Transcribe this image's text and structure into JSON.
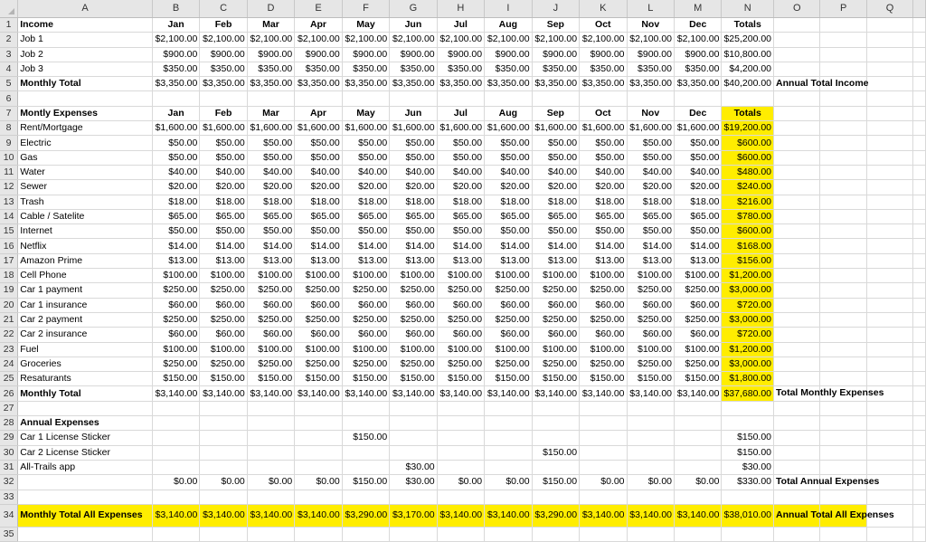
{
  "columns": [
    "A",
    "B",
    "C",
    "D",
    "E",
    "F",
    "G",
    "H",
    "I",
    "J",
    "K",
    "L",
    "M",
    "N",
    "O",
    "P",
    "Q"
  ],
  "highlight_color": "#ffed00",
  "rows": [
    {
      "n": "1",
      "a": "Income",
      "bold": true,
      "hdr": true,
      "vals": [
        "Jan",
        "Feb",
        "Mar",
        "Apr",
        "May",
        "Jun",
        "Jul",
        "Aug",
        "Sep",
        "Oct",
        "Nov",
        "Dec"
      ],
      "total": "Totals",
      "note": ""
    },
    {
      "n": "2",
      "a": "Job 1",
      "vals": [
        "$2,100.00",
        "$2,100.00",
        "$2,100.00",
        "$2,100.00",
        "$2,100.00",
        "$2,100.00",
        "$2,100.00",
        "$2,100.00",
        "$2,100.00",
        "$2,100.00",
        "$2,100.00",
        "$2,100.00"
      ],
      "total": "$25,200.00",
      "note": ""
    },
    {
      "n": "3",
      "a": "Job 2",
      "vals": [
        "$900.00",
        "$900.00",
        "$900.00",
        "$900.00",
        "$900.00",
        "$900.00",
        "$900.00",
        "$900.00",
        "$900.00",
        "$900.00",
        "$900.00",
        "$900.00"
      ],
      "total": "$10,800.00",
      "note": ""
    },
    {
      "n": "4",
      "a": "Job 3",
      "vals": [
        "$350.00",
        "$350.00",
        "$350.00",
        "$350.00",
        "$350.00",
        "$350.00",
        "$350.00",
        "$350.00",
        "$350.00",
        "$350.00",
        "$350.00",
        "$350.00"
      ],
      "total": "$4,200.00",
      "note": ""
    },
    {
      "n": "5",
      "a": "Monthly Total",
      "bold": true,
      "vals": [
        "$3,350.00",
        "$3,350.00",
        "$3,350.00",
        "$3,350.00",
        "$3,350.00",
        "$3,350.00",
        "$3,350.00",
        "$3,350.00",
        "$3,350.00",
        "$3,350.00",
        "$3,350.00",
        "$3,350.00"
      ],
      "total": "$40,200.00",
      "note": "Annual Total Income"
    },
    {
      "n": "6",
      "a": "",
      "vals": [
        "",
        "",
        "",
        "",
        "",
        "",
        "",
        "",
        "",
        "",
        "",
        ""
      ],
      "total": "",
      "note": ""
    },
    {
      "n": "7",
      "a": "Montly Expenses",
      "bold": true,
      "hdr": true,
      "vals": [
        "Jan",
        "Feb",
        "Mar",
        "Apr",
        "May",
        "Jun",
        "Jul",
        "Aug",
        "Sep",
        "Oct",
        "Nov",
        "Dec"
      ],
      "total": "Totals",
      "hlTotal": true,
      "note": ""
    },
    {
      "n": "8",
      "a": "Rent/Mortgage",
      "vals": [
        "$1,600.00",
        "$1,600.00",
        "$1,600.00",
        "$1,600.00",
        "$1,600.00",
        "$1,600.00",
        "$1,600.00",
        "$1,600.00",
        "$1,600.00",
        "$1,600.00",
        "$1,600.00",
        "$1,600.00"
      ],
      "total": "$19,200.00",
      "hlTotal": true,
      "note": ""
    },
    {
      "n": "9",
      "a": "Electric",
      "vals": [
        "$50.00",
        "$50.00",
        "$50.00",
        "$50.00",
        "$50.00",
        "$50.00",
        "$50.00",
        "$50.00",
        "$50.00",
        "$50.00",
        "$50.00",
        "$50.00"
      ],
      "total": "$600.00",
      "hlTotal": true,
      "note": ""
    },
    {
      "n": "10",
      "a": "Gas",
      "vals": [
        "$50.00",
        "$50.00",
        "$50.00",
        "$50.00",
        "$50.00",
        "$50.00",
        "$50.00",
        "$50.00",
        "$50.00",
        "$50.00",
        "$50.00",
        "$50.00"
      ],
      "total": "$600.00",
      "hlTotal": true,
      "note": ""
    },
    {
      "n": "11",
      "a": "Water",
      "vals": [
        "$40.00",
        "$40.00",
        "$40.00",
        "$40.00",
        "$40.00",
        "$40.00",
        "$40.00",
        "$40.00",
        "$40.00",
        "$40.00",
        "$40.00",
        "$40.00"
      ],
      "total": "$480.00",
      "hlTotal": true,
      "note": ""
    },
    {
      "n": "12",
      "a": "Sewer",
      "vals": [
        "$20.00",
        "$20.00",
        "$20.00",
        "$20.00",
        "$20.00",
        "$20.00",
        "$20.00",
        "$20.00",
        "$20.00",
        "$20.00",
        "$20.00",
        "$20.00"
      ],
      "total": "$240.00",
      "hlTotal": true,
      "note": ""
    },
    {
      "n": "13",
      "a": "Trash",
      "vals": [
        "$18.00",
        "$18.00",
        "$18.00",
        "$18.00",
        "$18.00",
        "$18.00",
        "$18.00",
        "$18.00",
        "$18.00",
        "$18.00",
        "$18.00",
        "$18.00"
      ],
      "total": "$216.00",
      "hlTotal": true,
      "note": ""
    },
    {
      "n": "14",
      "a": "Cable / Satelite",
      "vals": [
        "$65.00",
        "$65.00",
        "$65.00",
        "$65.00",
        "$65.00",
        "$65.00",
        "$65.00",
        "$65.00",
        "$65.00",
        "$65.00",
        "$65.00",
        "$65.00"
      ],
      "total": "$780.00",
      "hlTotal": true,
      "note": ""
    },
    {
      "n": "15",
      "a": "Internet",
      "vals": [
        "$50.00",
        "$50.00",
        "$50.00",
        "$50.00",
        "$50.00",
        "$50.00",
        "$50.00",
        "$50.00",
        "$50.00",
        "$50.00",
        "$50.00",
        "$50.00"
      ],
      "total": "$600.00",
      "hlTotal": true,
      "note": ""
    },
    {
      "n": "16",
      "a": "Netflix",
      "vals": [
        "$14.00",
        "$14.00",
        "$14.00",
        "$14.00",
        "$14.00",
        "$14.00",
        "$14.00",
        "$14.00",
        "$14.00",
        "$14.00",
        "$14.00",
        "$14.00"
      ],
      "total": "$168.00",
      "hlTotal": true,
      "note": ""
    },
    {
      "n": "17",
      "a": "Amazon Prime",
      "vals": [
        "$13.00",
        "$13.00",
        "$13.00",
        "$13.00",
        "$13.00",
        "$13.00",
        "$13.00",
        "$13.00",
        "$13.00",
        "$13.00",
        "$13.00",
        "$13.00"
      ],
      "total": "$156.00",
      "hlTotal": true,
      "note": ""
    },
    {
      "n": "18",
      "a": "Cell Phone",
      "vals": [
        "$100.00",
        "$100.00",
        "$100.00",
        "$100.00",
        "$100.00",
        "$100.00",
        "$100.00",
        "$100.00",
        "$100.00",
        "$100.00",
        "$100.00",
        "$100.00"
      ],
      "total": "$1,200.00",
      "hlTotal": true,
      "note": ""
    },
    {
      "n": "19",
      "a": "Car 1 payment",
      "vals": [
        "$250.00",
        "$250.00",
        "$250.00",
        "$250.00",
        "$250.00",
        "$250.00",
        "$250.00",
        "$250.00",
        "$250.00",
        "$250.00",
        "$250.00",
        "$250.00"
      ],
      "total": "$3,000.00",
      "hlTotal": true,
      "note": ""
    },
    {
      "n": "20",
      "a": "Car 1 insurance",
      "vals": [
        "$60.00",
        "$60.00",
        "$60.00",
        "$60.00",
        "$60.00",
        "$60.00",
        "$60.00",
        "$60.00",
        "$60.00",
        "$60.00",
        "$60.00",
        "$60.00"
      ],
      "total": "$720.00",
      "hlTotal": true,
      "note": ""
    },
    {
      "n": "21",
      "a": "Car 2 payment",
      "vals": [
        "$250.00",
        "$250.00",
        "$250.00",
        "$250.00",
        "$250.00",
        "$250.00",
        "$250.00",
        "$250.00",
        "$250.00",
        "$250.00",
        "$250.00",
        "$250.00"
      ],
      "total": "$3,000.00",
      "hlTotal": true,
      "note": ""
    },
    {
      "n": "22",
      "a": "Car 2 insurance",
      "vals": [
        "$60.00",
        "$60.00",
        "$60.00",
        "$60.00",
        "$60.00",
        "$60.00",
        "$60.00",
        "$60.00",
        "$60.00",
        "$60.00",
        "$60.00",
        "$60.00"
      ],
      "total": "$720.00",
      "hlTotal": true,
      "note": ""
    },
    {
      "n": "23",
      "a": "Fuel",
      "vals": [
        "$100.00",
        "$100.00",
        "$100.00",
        "$100.00",
        "$100.00",
        "$100.00",
        "$100.00",
        "$100.00",
        "$100.00",
        "$100.00",
        "$100.00",
        "$100.00"
      ],
      "total": "$1,200.00",
      "hlTotal": true,
      "note": ""
    },
    {
      "n": "24",
      "a": "Groceries",
      "vals": [
        "$250.00",
        "$250.00",
        "$250.00",
        "$250.00",
        "$250.00",
        "$250.00",
        "$250.00",
        "$250.00",
        "$250.00",
        "$250.00",
        "$250.00",
        "$250.00"
      ],
      "total": "$3,000.00",
      "hlTotal": true,
      "note": ""
    },
    {
      "n": "25",
      "a": "Resaturants",
      "vals": [
        "$150.00",
        "$150.00",
        "$150.00",
        "$150.00",
        "$150.00",
        "$150.00",
        "$150.00",
        "$150.00",
        "$150.00",
        "$150.00",
        "$150.00",
        "$150.00"
      ],
      "total": "$1,800.00",
      "hlTotal": true,
      "note": ""
    },
    {
      "n": "26",
      "a": "Monthly Total",
      "bold": true,
      "vals": [
        "$3,140.00",
        "$3,140.00",
        "$3,140.00",
        "$3,140.00",
        "$3,140.00",
        "$3,140.00",
        "$3,140.00",
        "$3,140.00",
        "$3,140.00",
        "$3,140.00",
        "$3,140.00",
        "$3,140.00"
      ],
      "total": "$37,680.00",
      "hlTotal": true,
      "note": "Total Monthly Expenses"
    },
    {
      "n": "27",
      "a": "",
      "vals": [
        "",
        "",
        "",
        "",
        "",
        "",
        "",
        "",
        "",
        "",
        "",
        ""
      ],
      "total": "",
      "note": ""
    },
    {
      "n": "28",
      "a": "Annual Expenses",
      "bold": true,
      "vals": [
        "",
        "",
        "",
        "",
        "",
        "",
        "",
        "",
        "",
        "",
        "",
        ""
      ],
      "total": "",
      "note": ""
    },
    {
      "n": "29",
      "a": "Car 1 License Sticker",
      "vals": [
        "",
        "",
        "",
        "",
        "$150.00",
        "",
        "",
        "",
        "",
        "",
        "",
        ""
      ],
      "total": "$150.00",
      "note": ""
    },
    {
      "n": "30",
      "a": "Car 2 License Sticker",
      "vals": [
        "",
        "",
        "",
        "",
        "",
        "",
        "",
        "",
        "$150.00",
        "",
        "",
        ""
      ],
      "total": "$150.00",
      "note": ""
    },
    {
      "n": "31",
      "a": "All-Trails app",
      "vals": [
        "",
        "",
        "",
        "",
        "",
        "$30.00",
        "",
        "",
        "",
        "",
        "",
        ""
      ],
      "total": "$30.00",
      "note": ""
    },
    {
      "n": "32",
      "a": "",
      "vals": [
        "$0.00",
        "$0.00",
        "$0.00",
        "$0.00",
        "$150.00",
        "$30.00",
        "$0.00",
        "$0.00",
        "$150.00",
        "$0.00",
        "$0.00",
        "$0.00"
      ],
      "total": "$330.00",
      "note": "Total Annual Expenses"
    },
    {
      "n": "33",
      "a": "",
      "vals": [
        "",
        "",
        "",
        "",
        "",
        "",
        "",
        "",
        "",
        "",
        "",
        ""
      ],
      "total": "",
      "note": ""
    },
    {
      "n": "34",
      "a": "Monthly Total All Expenses",
      "bold": true,
      "hlRow": true,
      "tall": true,
      "vals": [
        "$3,140.00",
        "$3,140.00",
        "$3,140.00",
        "$3,140.00",
        "$3,290.00",
        "$3,170.00",
        "$3,140.00",
        "$3,140.00",
        "$3,290.00",
        "$3,140.00",
        "$3,140.00",
        "$3,140.00"
      ],
      "total": "$38,010.00",
      "note": "Annual Total All Expenses"
    },
    {
      "n": "35",
      "a": "",
      "vals": [
        "",
        "",
        "",
        "",
        "",
        "",
        "",
        "",
        "",
        "",
        "",
        ""
      ],
      "total": "",
      "note": ""
    }
  ]
}
